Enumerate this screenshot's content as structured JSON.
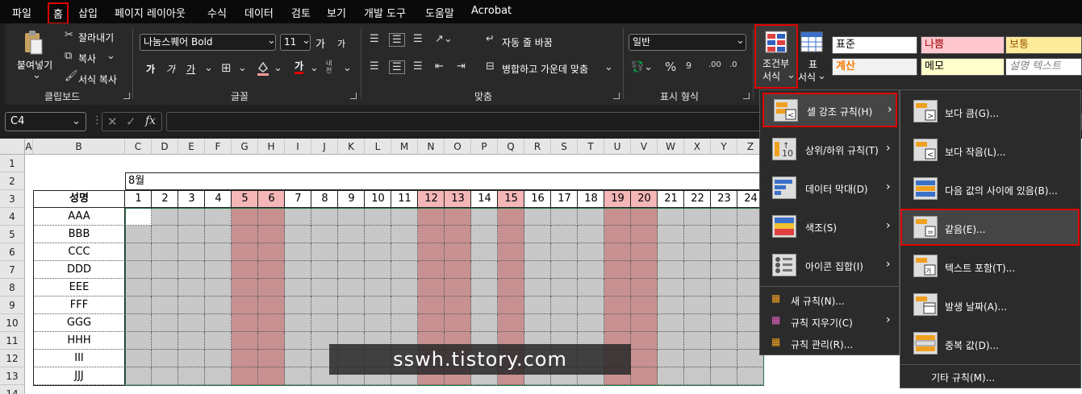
{
  "menubar": {
    "tabs": [
      "파일",
      "홈",
      "삽입",
      "페이지 레이아웃",
      "수식",
      "데이터",
      "검토",
      "보기",
      "개발 도구",
      "도움말",
      "Acrobat"
    ],
    "active_tab": "홈"
  },
  "clipboard": {
    "paste": "붙여넣기",
    "cut": "잘라내기",
    "copy": "복사",
    "format_painter": "서식 복사",
    "group": "클립보드"
  },
  "font": {
    "name": "나눔스퀘어 Bold",
    "size": "11",
    "grow": "가",
    "shrink": "가",
    "bold": "가",
    "italic": "가",
    "underline": "가",
    "font_color_glyph": "가",
    "phonetic": "내천",
    "group": "글꼴"
  },
  "alignment": {
    "wrap_text": "자동 줄 바꿈",
    "merge_center": "병합하고 가운데 맞춤",
    "group": "맞춤"
  },
  "number": {
    "format": "일반",
    "group": "표시 형식"
  },
  "styles": {
    "conditional_formatting": [
      "조건부",
      "서식"
    ],
    "format_as_table": [
      "표",
      "서식"
    ],
    "cells": [
      {
        "label": "표준",
        "bg": "#ffffff",
        "fg": "#000000"
      },
      {
        "label": "나쁨",
        "bg": "#ffc7ce",
        "fg": "#9c0006"
      },
      {
        "label": "보통",
        "bg": "#ffeb9c",
        "fg": "#9c5700"
      },
      {
        "label": "계산",
        "bg": "#f2f2f2",
        "fg": "#fa7d00"
      },
      {
        "label": "메모",
        "bg": "#ffffcc",
        "fg": "#000000"
      },
      {
        "label": "설명 텍스트",
        "bg": "#ffffff",
        "fg": "#7f7f7f"
      }
    ]
  },
  "formula_bar": {
    "name_box": "C4",
    "fx": "fx"
  },
  "sheet": {
    "col_a": "A",
    "col_b": "B",
    "day_columns": [
      "C",
      "D",
      "E",
      "F",
      "G",
      "H",
      "I",
      "J",
      "K",
      "L",
      "M",
      "N",
      "O",
      "P",
      "Q",
      "R",
      "S",
      "T",
      "U",
      "V",
      "W",
      "X",
      "Y",
      "Z"
    ],
    "row_numbers": [
      "1",
      "2",
      "3",
      "4",
      "5",
      "6",
      "7",
      "8",
      "9",
      "10",
      "11",
      "12",
      "13",
      "14"
    ],
    "month_label": "8월",
    "name_header": "성명",
    "days": [
      "1",
      "2",
      "3",
      "4",
      "5",
      "6",
      "7",
      "8",
      "9",
      "10",
      "11",
      "12",
      "13",
      "14",
      "15",
      "16",
      "17",
      "18",
      "19",
      "20",
      "21",
      "22",
      "23",
      "24"
    ],
    "weekend_days": [
      5,
      6,
      12,
      13,
      15,
      19,
      20
    ],
    "names": [
      "AAA",
      "BBB",
      "CCC",
      "DDD",
      "EEE",
      "FFF",
      "GGG",
      "HHH",
      "III",
      "JJJ"
    ],
    "colors": {
      "weekend_header": "#f4b6b6",
      "weekend_fill": "#c79191",
      "fill": "#c8c8c8"
    }
  },
  "cf_menu": {
    "items": [
      {
        "label": "셀 강조 규칙(H)",
        "has_sub": true
      },
      {
        "label": "상위/하위 규칙(T)",
        "has_sub": true
      },
      {
        "label": "데이터 막대(D)",
        "has_sub": true
      },
      {
        "label": "색조(S)",
        "has_sub": true
      },
      {
        "label": "아이콘 집합(I)",
        "has_sub": true
      }
    ],
    "bottom": [
      {
        "label": "새 규칙(N)..."
      },
      {
        "label": "규칙 지우기(C)",
        "has_sub": true
      },
      {
        "label": "규칙 관리(R)..."
      }
    ]
  },
  "highlight_sub": {
    "items": [
      {
        "label": "보다 큼(G)..."
      },
      {
        "label": "보다 작음(L)..."
      },
      {
        "label": "다음 값의 사이에 있음(B)..."
      },
      {
        "label": "같음(E)..."
      },
      {
        "label": "텍스트 포함(T)..."
      },
      {
        "label": "발생 날짜(A)..."
      },
      {
        "label": "중복 값(D)..."
      }
    ],
    "more": "기타 규칙(M)..."
  },
  "watermark": "sswh.tistory.com"
}
